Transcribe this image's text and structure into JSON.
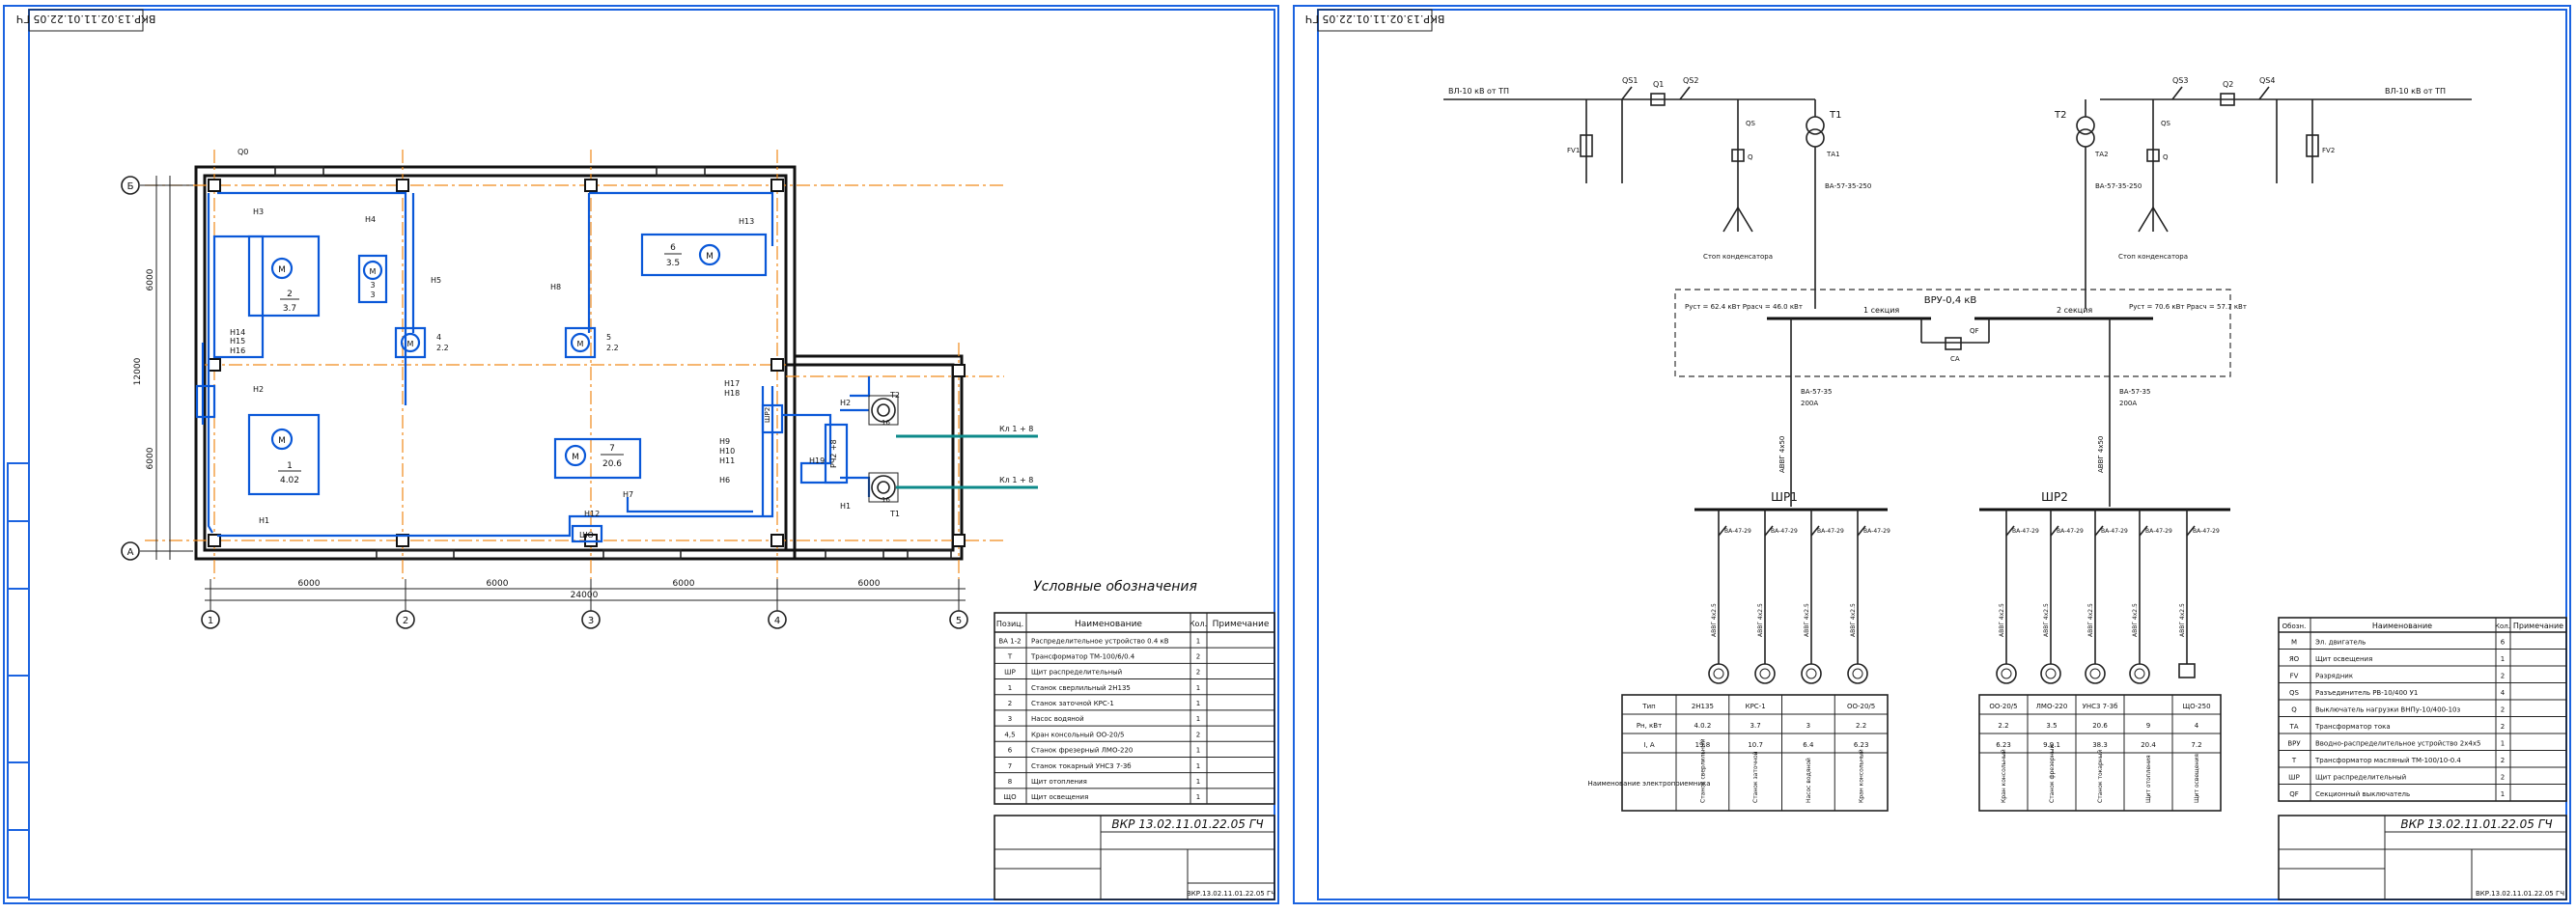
{
  "sheet1": {
    "stamp": "ВКР.13.02.11.01.22.05 ГЧ",
    "code": "ВКР 13.02.11.01.22.05 ГЧ",
    "axes_letters": [
      "Б",
      "А"
    ],
    "axes_numbers": [
      "1",
      "2",
      "3",
      "4",
      "5"
    ],
    "dims_bottom": [
      "6000",
      "6000",
      "6000",
      "6000"
    ],
    "dim_total": "24000",
    "dims_left": [
      "6000",
      "12000",
      "6000"
    ],
    "labels": {
      "n3": "Н3",
      "n4": "Н4",
      "n5": "Н5",
      "n13": "Н13",
      "n12": "Н12",
      "n8": "Н8",
      "n14": "Н14",
      "n15": "Н15",
      "n2": "Н2",
      "n7": "Н7",
      "n9": "Н9",
      "n10": "Н10",
      "n11": "Н11",
      "n6": "Н6",
      "n16": "Н16",
      "n17": "Н17",
      "n18": "Н18",
      "n1": "Н1",
      "n19": "Н19",
      "w1": "Н1",
      "w2": "Н2",
      "shr": "ШР2",
      "pr": "РЧ2 +8",
      "t1": "Т1",
      "t2": "Т2",
      "kl1": "Кл 1 + 8",
      "kl2": "Кл 1 + 8",
      "shch": "ШО",
      "q0": "Q0",
      "m": "М"
    },
    "legend": {
      "title": "Условные обозначения",
      "headers": [
        "Позиц.",
        "Наименование",
        "Кол.",
        "Примечание"
      ],
      "rows": [
        [
          "ВА 1-2",
          "Распределительное устройство 0.4 кВ",
          "1",
          ""
        ],
        [
          "Т",
          "Трансформатор ТМ-100/6/0.4",
          "2",
          ""
        ],
        [
          "ШР",
          "Щит распределительный",
          "2",
          ""
        ],
        [
          "1",
          "Станок сверлильный 2Н135",
          "1",
          ""
        ],
        [
          "2",
          "Станок заточной КРС-1",
          "1",
          ""
        ],
        [
          "3",
          "Насос водяной",
          "1",
          ""
        ],
        [
          "4,5",
          "Кран консольный ОО-20/5",
          "2",
          ""
        ],
        [
          "6",
          "Станок фрезерный ЛМО-220",
          "1",
          ""
        ],
        [
          "7",
          "Станок токарный УНС3 7-3б",
          "1",
          ""
        ],
        [
          "8",
          "Щит отопления",
          "1",
          ""
        ],
        [
          "ЩО",
          "Щит освещения",
          "1",
          ""
        ]
      ]
    }
  },
  "sheet2": {
    "stamp": "ВКР.13.02.11.01.22.05 ГЧ",
    "code": "ВКР 13.02.11.01.22.05 ГЧ",
    "labels": {
      "line1": "ВЛ-10 кВ от ТП",
      "line2": "ВЛ-10 кВ от ТП",
      "qs1": "QS1",
      "q1": "Q1",
      "qs2": "QS2",
      "qs3": "QS3",
      "q2": "Q2",
      "qs4": "QS4",
      "t1": "Т1",
      "t2": "Т2",
      "ta1": "ТА1",
      "ta2": "ТА2",
      "fv1": "FV1",
      "fv2": "FV2",
      "qs5": "QS",
      "qs6": "QS",
      "q5": "Q",
      "q6": "Q",
      "gnd1": "Стоп конденсатора",
      "gnd2": "Стоп конденсатора",
      "cable1": "ВА-57-35-250",
      "cable2": "ВА-57-35-250",
      "vru": "ВРУ-0,4 кВ",
      "sec1": "1 секция",
      "sec2": "2 секция",
      "pset1": "Pуст = 62.4 кВт  Pрасч = 46.0 кВт",
      "pset2": "Pуст = 70.6 кВт  Pрасч = 57.7 кВт",
      "qsec": "QF",
      "sa": "СА",
      "feeder1": "ВА-57-35",
      "feeder2": "ВА-57-35",
      "amp1": "200А",
      "amp2": "200А",
      "cab1": "АВВГ 4х50",
      "cab2": "АВВГ 4х50",
      "shr1": "ШР1",
      "shr2": "ШР2",
      "sub_breaker": "ВА-47-29",
      "sub_cable": "АВВГ 4х2.5"
    },
    "load_table": {
      "row_labels": [
        "Тип",
        "Pн, кВт",
        "I, А",
        "Наименование электроприемника"
      ],
      "cols1": [
        [
          "2Н135",
          "4.0.2",
          "19.8",
          "Станок сверлильный"
        ],
        [
          "КРС-1",
          "3.7",
          "10.7",
          "Станок заточной"
        ],
        [
          "",
          "3",
          "6.4",
          "Насос водяной"
        ],
        [
          "ОО-20/5",
          "2.2",
          "6.23",
          "Кран консольный"
        ]
      ],
      "cols2": [
        [
          "ОО-20/5",
          "2.2",
          "6.23",
          "Кран консольный"
        ],
        [
          "ЛМО-220",
          "3.5",
          "9.9.1",
          "Станок фрезерный"
        ],
        [
          "УНС3 7-3б",
          "20.6",
          "38.3",
          "Станок токарный"
        ],
        [
          "",
          "9",
          "20.4",
          "Щит отопления"
        ],
        [
          "ЩО-250",
          "4",
          "7.2",
          "Щит освещения"
        ]
      ]
    },
    "legend": {
      "headers": [
        "Обозн.",
        "Наименование",
        "Кол.",
        "Примечание"
      ],
      "rows": [
        [
          "M",
          "Эл. двигатель",
          "6",
          ""
        ],
        [
          "ЯО",
          "Щит освещения",
          "1",
          ""
        ],
        [
          "FV",
          "Разрядник",
          "2",
          ""
        ],
        [
          "QS",
          "Разъединитель РВ-10/400 У1",
          "4",
          ""
        ],
        [
          "Q",
          "Выключатель нагрузки ВНПу-10/400-10з",
          "2",
          ""
        ],
        [
          "ТА",
          "Трансформатор тока",
          "2",
          ""
        ],
        [
          "ВРУ",
          "Вводно-распределительное устройство 2х4х5",
          "1",
          ""
        ],
        [
          "Т",
          "Трансформатор масляный ТМ-100/10-0.4",
          "2",
          ""
        ],
        [
          "ШР",
          "Щит распределительный",
          "2",
          ""
        ],
        [
          "QF",
          "Секционный выключатель",
          "1",
          ""
        ]
      ]
    }
  }
}
